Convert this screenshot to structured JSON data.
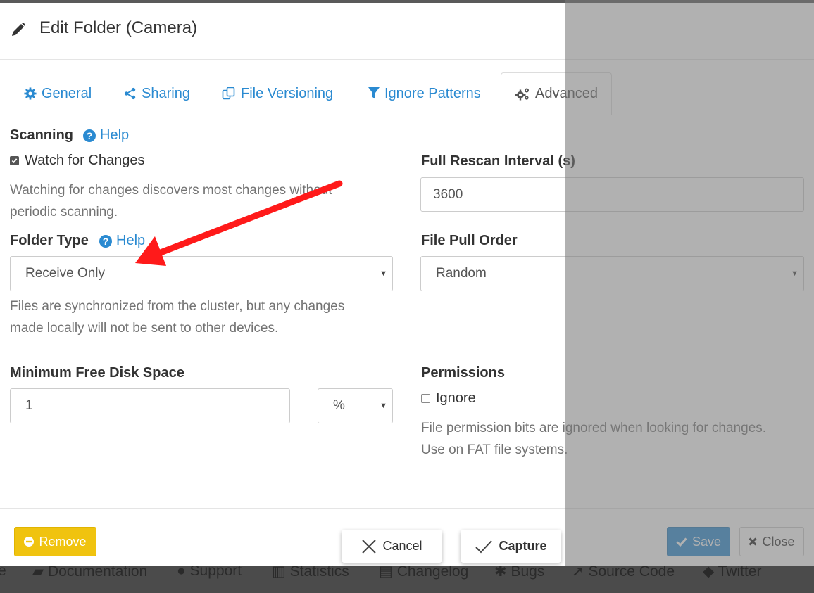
{
  "background_footer": {
    "items": [
      "e",
      "Documentation",
      "Support",
      "Statistics",
      "Changelog",
      "Bugs",
      "Source Code",
      "Twitter"
    ]
  },
  "header": {
    "title": "Edit Folder (Camera)",
    "icon": "pencil-icon"
  },
  "tabs": [
    {
      "label": "General",
      "icon": "gear-icon"
    },
    {
      "label": "Sharing",
      "icon": "share-icon"
    },
    {
      "label": "File Versioning",
      "icon": "copy-icon"
    },
    {
      "label": "Ignore Patterns",
      "icon": "filter-icon"
    },
    {
      "label": "Advanced",
      "icon": "gears-icon",
      "active": true
    }
  ],
  "scanning": {
    "label": "Scanning",
    "help": "Help",
    "watch_label": "Watch for Changes",
    "watch_checked": true,
    "hint_line1": "Watching for changes discovers most changes without",
    "hint_line2": "periodic scanning."
  },
  "rescan": {
    "label": "Full Rescan Interval (s)",
    "value": "3600"
  },
  "folder_type": {
    "label": "Folder Type",
    "help": "Help",
    "value": "Receive Only",
    "hint_line1": "Files are synchronized from the cluster, but any changes",
    "hint_line2": "made locally will not be sent to other devices."
  },
  "pull_order": {
    "label": "File Pull Order",
    "value": "Random"
  },
  "min_disk": {
    "label": "Minimum Free Disk Space",
    "value": "1",
    "unit": "%"
  },
  "permissions": {
    "label": "Permissions",
    "ignore_label": "Ignore",
    "ignore_checked": false,
    "hint_line1": "File permission bits are ignored when looking for changes.",
    "hint_line2": "Use on FAT file systems."
  },
  "footer": {
    "remove": "Remove",
    "save": "Save",
    "close": "Close"
  },
  "capture_bar": {
    "cancel": "Cancel",
    "capture": "Capture"
  },
  "colors": {
    "primary": "#2a8ad1",
    "warning": "#f0c30f",
    "annotation": "#ff0000"
  }
}
